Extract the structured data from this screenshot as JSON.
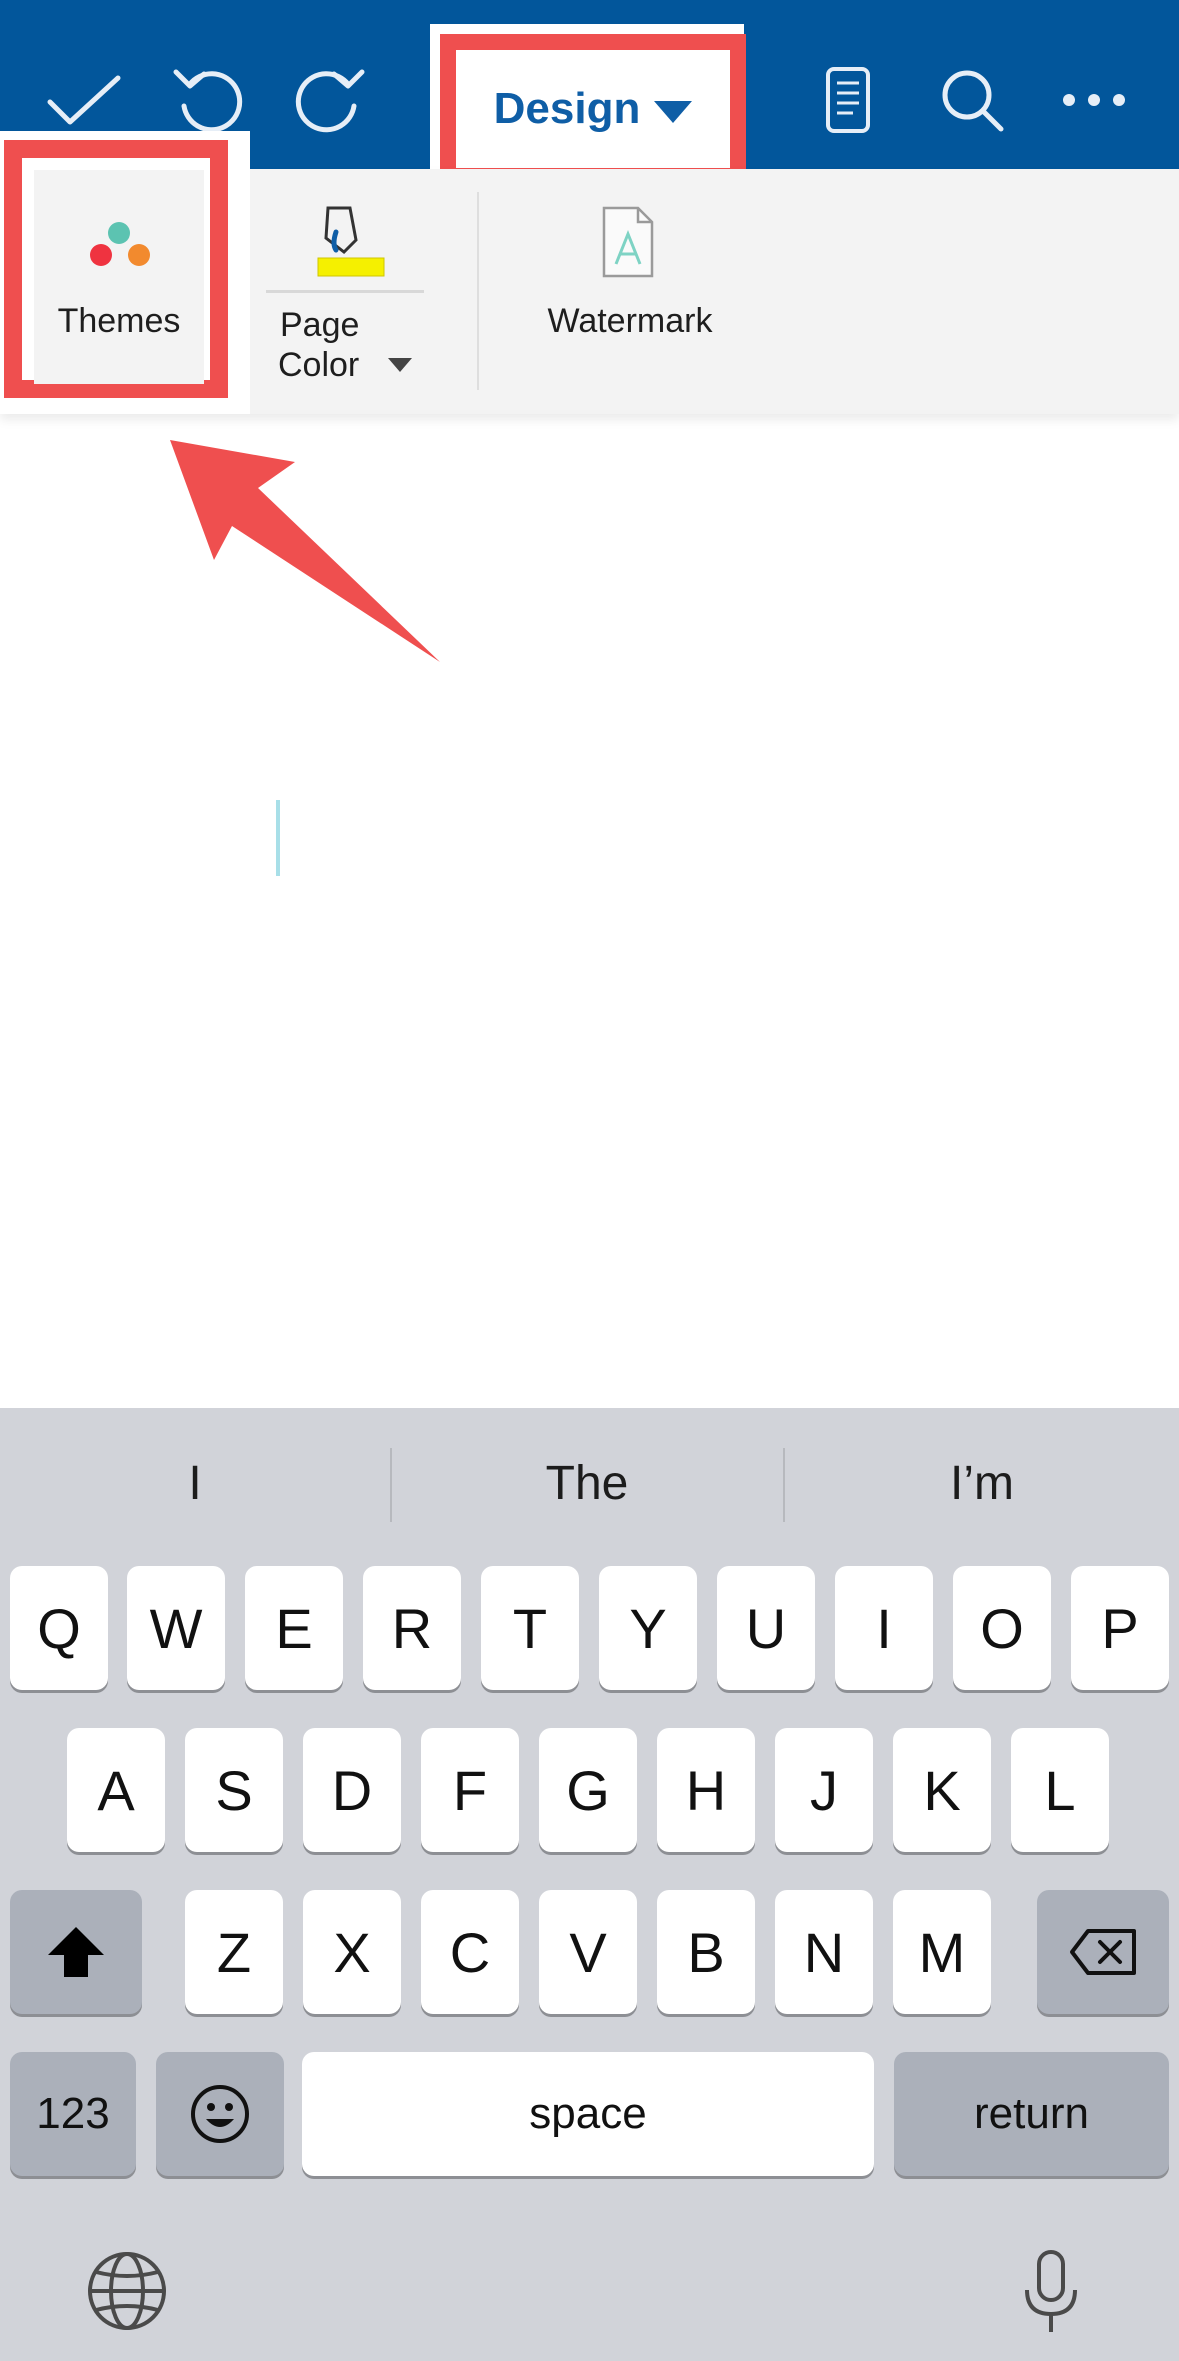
{
  "toolbar": {
    "design_label": "Design",
    "colors": {
      "bar": "#02569b",
      "highlight": "#ef4f4f"
    }
  },
  "ribbon": {
    "themes_label": "Themes",
    "page_color_line1": "Page",
    "page_color_line2": "Color",
    "watermark_label": "Watermark",
    "theme_dot_colors": [
      "#5cc3b1",
      "#ef3340",
      "#f28a2e"
    ]
  },
  "keyboard": {
    "suggestions": [
      "I",
      "The",
      "I’m"
    ],
    "row1": [
      "Q",
      "W",
      "E",
      "R",
      "T",
      "Y",
      "U",
      "I",
      "O",
      "P"
    ],
    "row2": [
      "A",
      "S",
      "D",
      "F",
      "G",
      "H",
      "J",
      "K",
      "L"
    ],
    "row3": [
      "Z",
      "X",
      "C",
      "V",
      "B",
      "N",
      "M"
    ],
    "numbers_label": "123",
    "space_label": "space",
    "return_label": "return"
  }
}
